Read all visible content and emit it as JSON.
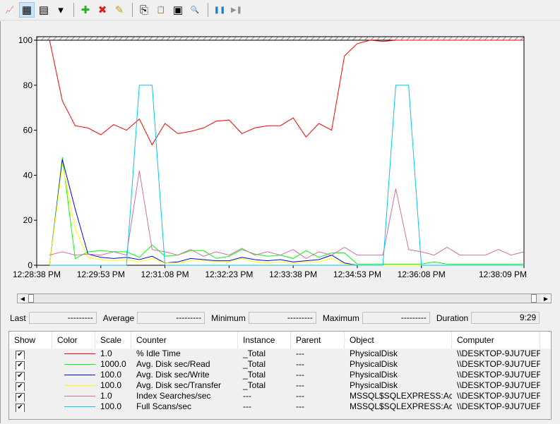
{
  "toolbar": {
    "buttons": [
      {
        "name": "view-graph-icon",
        "glyph": "📈"
      },
      {
        "name": "view-histogram-icon",
        "glyph": "▦",
        "active": true
      },
      {
        "name": "view-report-icon",
        "glyph": "▤"
      },
      {
        "name": "change-graph-type-dropdown-icon",
        "glyph": "▾"
      },
      {
        "name": "add-counter-icon",
        "glyph": "✚",
        "color": "#1fb51f"
      },
      {
        "name": "delete-counter-icon",
        "glyph": "✖",
        "color": "#e02020"
      },
      {
        "name": "highlight-icon",
        "glyph": "✎",
        "color": "#c8a020"
      },
      {
        "name": "copy-properties-icon",
        "glyph": "⎘"
      },
      {
        "name": "paste-counter-list-icon",
        "glyph": "📋"
      },
      {
        "name": "properties-icon",
        "glyph": "▣"
      },
      {
        "name": "zoom-icon",
        "glyph": "🔍"
      },
      {
        "name": "freeze-display-icon",
        "glyph": "❚❚",
        "color": "#1a7fd0"
      },
      {
        "name": "update-data-icon",
        "glyph": "▶❚",
        "color": "#909090"
      }
    ]
  },
  "chart_data": {
    "type": "line",
    "ylim": [
      0,
      100
    ],
    "yticks": [
      "0",
      "20",
      "40",
      "60",
      "80",
      "100"
    ],
    "xtick_labels": [
      {
        "index": 0,
        "label": "12:28:38 PM"
      },
      {
        "index": 5,
        "label": "12:29:53 PM"
      },
      {
        "index": 10,
        "label": "12:31:08 PM"
      },
      {
        "index": 15,
        "label": "12:32:23 PM"
      },
      {
        "index": 20,
        "label": "12:33:38 PM"
      },
      {
        "index": 25,
        "label": "12:34:53 PM"
      },
      {
        "index": 30,
        "label": "12:36:08 PM"
      },
      {
        "index": 38,
        "label": "12:38:09 PM"
      }
    ],
    "num_samples": 39,
    "series": [
      {
        "name": "% Idle Time",
        "color": "#ff0000",
        "values": [
          null,
          100,
          73,
          62,
          61,
          58,
          62.5,
          60,
          65,
          53.5,
          63,
          58.5,
          59.5,
          61,
          64,
          64.5,
          58.5,
          61,
          62,
          62,
          65.5,
          57,
          63,
          60,
          93,
          98.5,
          100,
          99.5,
          100,
          100,
          100,
          100,
          100,
          100,
          100,
          100,
          100,
          100,
          100
        ]
      },
      {
        "name": "Avg. Disk sec/Read",
        "color": "#00ff00",
        "values": [
          null,
          0,
          48,
          3,
          6,
          6.5,
          6,
          6,
          3.5,
          9,
          4,
          4.5,
          6.5,
          6.5,
          3,
          4,
          7,
          5,
          4,
          4.5,
          3,
          6.5,
          3.5,
          5.5,
          5.5,
          0.5,
          0.5,
          0.5,
          0.5,
          0.5,
          0.5,
          1.5,
          0.5,
          0.5,
          0.5,
          0.5,
          0.5,
          0.5,
          0.5
        ]
      },
      {
        "name": "Avg. Disk sec/Write",
        "color": "#0000ff",
        "values": [
          null,
          0,
          47,
          25,
          5,
          3.5,
          3,
          3.5,
          2.5,
          4,
          1,
          1.5,
          3,
          2.5,
          2,
          2,
          3.5,
          2.5,
          2,
          2.5,
          1.5,
          2,
          2.5,
          4.5,
          1,
          0,
          0,
          0,
          0,
          0,
          0,
          0,
          0,
          0,
          0,
          0,
          0,
          0,
          0
        ]
      },
      {
        "name": "Avg. Disk sec/Transfer",
        "color": "#ffff00",
        "values": [
          null,
          0,
          45,
          16,
          3.5,
          2.5,
          2,
          2.5,
          1.5,
          3,
          1,
          1,
          2,
          2,
          1.5,
          1.5,
          3,
          1.5,
          1,
          1.5,
          1,
          1.5,
          1.5,
          3,
          0.5,
          0,
          0,
          0,
          0,
          0,
          0,
          0,
          0,
          0,
          0,
          0,
          0,
          0,
          0
        ]
      },
      {
        "name": "Index Searches/sec",
        "color": "#d070a0",
        "values": [
          null,
          4.5,
          6,
          4.5,
          5,
          4.5,
          6,
          4.5,
          42,
          7,
          6,
          4.5,
          7,
          4,
          6,
          4.5,
          7.5,
          4.5,
          6,
          4.5,
          7,
          3,
          6,
          4.5,
          8,
          4.5,
          4.5,
          4.5,
          34,
          7,
          6,
          4.5,
          8,
          4.5,
          4.5,
          4.5,
          7,
          4.5,
          6
        ]
      },
      {
        "name": "Full Scans/sec",
        "color": "#00c8f0",
        "values": [
          null,
          0,
          0,
          0,
          0,
          0,
          0,
          0,
          80,
          80,
          0,
          0,
          0,
          0,
          0,
          0,
          0,
          0,
          0,
          0,
          0,
          0,
          0,
          0,
          0,
          0,
          0,
          0,
          80,
          80,
          0,
          0,
          0,
          0,
          0,
          0,
          0,
          0,
          0
        ]
      }
    ]
  },
  "stats": {
    "last_label": "Last",
    "last_value": "---------",
    "average_label": "Average",
    "average_value": "---------",
    "minimum_label": "Minimum",
    "minimum_value": "---------",
    "maximum_label": "Maximum",
    "maximum_value": "---------",
    "duration_label": "Duration",
    "duration_value": "9:29"
  },
  "table": {
    "headers": [
      "Show",
      "Color",
      "Scale",
      "Counter",
      "Instance",
      "Parent",
      "Object",
      "Computer"
    ],
    "rows": [
      {
        "show": true,
        "color": "#ff0000",
        "scale": "1.0",
        "counter": "% Idle Time",
        "instance": "_Total",
        "parent": "---",
        "object": "PhysicalDisk",
        "computer": "\\\\DESKTOP-9JU7UEF"
      },
      {
        "show": true,
        "color": "#00ff00",
        "scale": "1000.0",
        "counter": "Avg. Disk sec/Read",
        "instance": "_Total",
        "parent": "---",
        "object": "PhysicalDisk",
        "computer": "\\\\DESKTOP-9JU7UEF"
      },
      {
        "show": true,
        "color": "#0000ff",
        "scale": "100.0",
        "counter": "Avg. Disk sec/Write",
        "instance": "_Total",
        "parent": "---",
        "object": "PhysicalDisk",
        "computer": "\\\\DESKTOP-9JU7UEF"
      },
      {
        "show": true,
        "color": "#ffff00",
        "scale": "100.0",
        "counter": "Avg. Disk sec/Transfer",
        "instance": "_Total",
        "parent": "---",
        "object": "PhysicalDisk",
        "computer": "\\\\DESKTOP-9JU7UEF"
      },
      {
        "show": true,
        "color": "#d070a0",
        "scale": "1.0",
        "counter": "Index Searches/sec",
        "instance": "---",
        "parent": "---",
        "object": "MSSQL$SQLEXPRESS:Acc...",
        "computer": "\\\\DESKTOP-9JU7UEF"
      },
      {
        "show": true,
        "color": "#00c8f0",
        "scale": "100.0",
        "counter": "Full Scans/sec",
        "instance": "---",
        "parent": "---",
        "object": "MSSQL$SQLEXPRESS:Acc...",
        "computer": "\\\\DESKTOP-9JU7UEF"
      }
    ]
  }
}
